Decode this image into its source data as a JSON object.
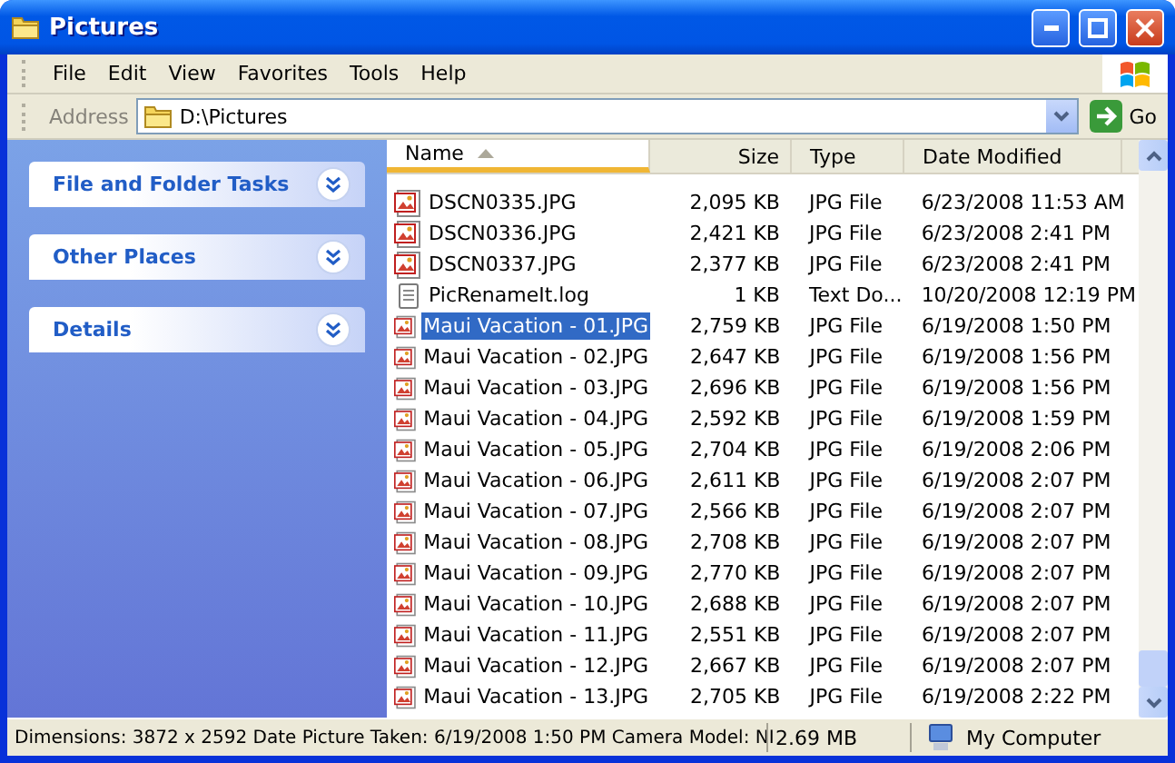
{
  "window": {
    "title": "Pictures"
  },
  "menu": [
    "File",
    "Edit",
    "View",
    "Favorites",
    "Tools",
    "Help"
  ],
  "address": {
    "label": "Address",
    "value": "D:\\Pictures",
    "go": "Go"
  },
  "tasks": [
    {
      "title": "File and Folder Tasks",
      "expanded": false
    },
    {
      "title": "Other Places",
      "expanded": false
    },
    {
      "title": "Details",
      "expanded": false
    }
  ],
  "columns": [
    {
      "label": "Name",
      "sorted": true
    },
    {
      "label": "Size",
      "sorted": false
    },
    {
      "label": "Type",
      "sorted": false
    },
    {
      "label": "Date Modified",
      "sorted": false
    }
  ],
  "files": [
    {
      "kind": "image",
      "name": "DSCN0335.JPG",
      "size": "2,095 KB",
      "type": "JPG File",
      "date": "6/23/2008 11:53 AM",
      "selected": false
    },
    {
      "kind": "image",
      "name": "DSCN0336.JPG",
      "size": "2,421 KB",
      "type": "JPG File",
      "date": "6/23/2008 2:41 PM",
      "selected": false
    },
    {
      "kind": "image",
      "name": "DSCN0337.JPG",
      "size": "2,377 KB",
      "type": "JPG File",
      "date": "6/23/2008 2:41 PM",
      "selected": false
    },
    {
      "kind": "text",
      "name": "PicRenameIt.log",
      "size": "1 KB",
      "type": "Text Do...",
      "date": "10/20/2008 12:19 PM",
      "selected": false
    },
    {
      "kind": "image",
      "name": "Maui Vacation - 01.JPG",
      "size": "2,759 KB",
      "type": "JPG File",
      "date": "6/19/2008 1:50 PM",
      "selected": true
    },
    {
      "kind": "image",
      "name": "Maui Vacation - 02.JPG",
      "size": "2,647 KB",
      "type": "JPG File",
      "date": "6/19/2008 1:56 PM",
      "selected": false
    },
    {
      "kind": "image",
      "name": "Maui Vacation - 03.JPG",
      "size": "2,696 KB",
      "type": "JPG File",
      "date": "6/19/2008 1:56 PM",
      "selected": false
    },
    {
      "kind": "image",
      "name": "Maui Vacation - 04.JPG",
      "size": "2,592 KB",
      "type": "JPG File",
      "date": "6/19/2008 1:59 PM",
      "selected": false
    },
    {
      "kind": "image",
      "name": "Maui Vacation - 05.JPG",
      "size": "2,704 KB",
      "type": "JPG File",
      "date": "6/19/2008 2:06 PM",
      "selected": false
    },
    {
      "kind": "image",
      "name": "Maui Vacation - 06.JPG",
      "size": "2,611 KB",
      "type": "JPG File",
      "date": "6/19/2008 2:07 PM",
      "selected": false
    },
    {
      "kind": "image",
      "name": "Maui Vacation - 07.JPG",
      "size": "2,566 KB",
      "type": "JPG File",
      "date": "6/19/2008 2:07 PM",
      "selected": false
    },
    {
      "kind": "image",
      "name": "Maui Vacation - 08.JPG",
      "size": "2,708 KB",
      "type": "JPG File",
      "date": "6/19/2008 2:07 PM",
      "selected": false
    },
    {
      "kind": "image",
      "name": "Maui Vacation - 09.JPG",
      "size": "2,770 KB",
      "type": "JPG File",
      "date": "6/19/2008 2:07 PM",
      "selected": false
    },
    {
      "kind": "image",
      "name": "Maui Vacation - 10.JPG",
      "size": "2,688 KB",
      "type": "JPG File",
      "date": "6/19/2008 2:07 PM",
      "selected": false
    },
    {
      "kind": "image",
      "name": "Maui Vacation - 11.JPG",
      "size": "2,551 KB",
      "type": "JPG File",
      "date": "6/19/2008 2:07 PM",
      "selected": false
    },
    {
      "kind": "image",
      "name": "Maui Vacation - 12.JPG",
      "size": "2,667 KB",
      "type": "JPG File",
      "date": "6/19/2008 2:07 PM",
      "selected": false
    },
    {
      "kind": "image",
      "name": "Maui Vacation - 13.JPG",
      "size": "2,705 KB",
      "type": "JPG File",
      "date": "6/19/2008 2:22 PM",
      "selected": false
    }
  ],
  "status_bar": {
    "details": "Dimensions: 3872 x 2592 Date Picture Taken: 6/19/2008 1:50 PM Camera Model: NI",
    "size": "2.69 MB",
    "zone": "My Computer"
  }
}
